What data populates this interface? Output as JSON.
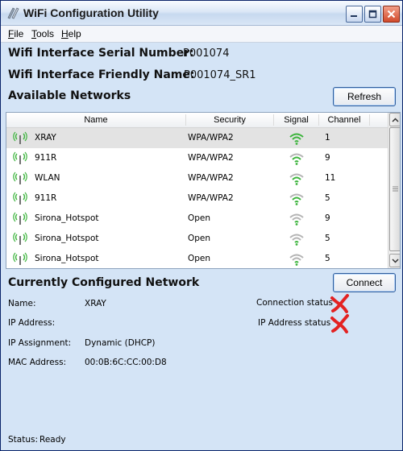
{
  "window": {
    "title": "WiFi Configuration Utility"
  },
  "menu": {
    "file": "File",
    "tools": "Tools",
    "help": "Help"
  },
  "interface": {
    "serial_label": "Wifi Interface Serial Number:",
    "serial_value": "P001074",
    "friendly_label": "Wifi Interface Friendly Name:",
    "friendly_value": "P001074_SR1"
  },
  "networks": {
    "heading": "Available Networks",
    "refresh_label": "Refresh",
    "columns": {
      "name": "Name",
      "security": "Security",
      "signal": "Signal",
      "channel": "Channel"
    },
    "rows": [
      {
        "name": "XRAY",
        "security": "WPA/WPA2",
        "channel": "1"
      },
      {
        "name": "911R",
        "security": "WPA/WPA2",
        "channel": "9"
      },
      {
        "name": "WLAN",
        "security": "WPA/WPA2",
        "channel": "11"
      },
      {
        "name": "911R",
        "security": "WPA/WPA2",
        "channel": "5"
      },
      {
        "name": "Sirona_Hotspot",
        "security": "Open",
        "channel": "9"
      },
      {
        "name": "Sirona_Hotspot",
        "security": "Open",
        "channel": "5"
      },
      {
        "name": "Sirona_Hotspot",
        "security": "Open",
        "channel": "5"
      }
    ]
  },
  "configured": {
    "heading": "Currently Configured Network",
    "connect_label": "Connect",
    "name_label": "Name:",
    "name_value": "XRAY",
    "ip_label": "IP Address:",
    "ip_value": "",
    "assignment_label": "IP Assignment:",
    "assignment_value": "Dynamic (DHCP)",
    "mac_label": "MAC Address:",
    "mac_value": "00:0B:6C:CC:00:D8",
    "connection_status_label": "Connection status",
    "ip_status_label": "IP Address status"
  },
  "status": {
    "label": "Status:",
    "value": "Ready"
  },
  "colors": {
    "signal_green": "#3cb43c",
    "signal_grey": "#b4b4b4",
    "error_red": "#e32222"
  }
}
